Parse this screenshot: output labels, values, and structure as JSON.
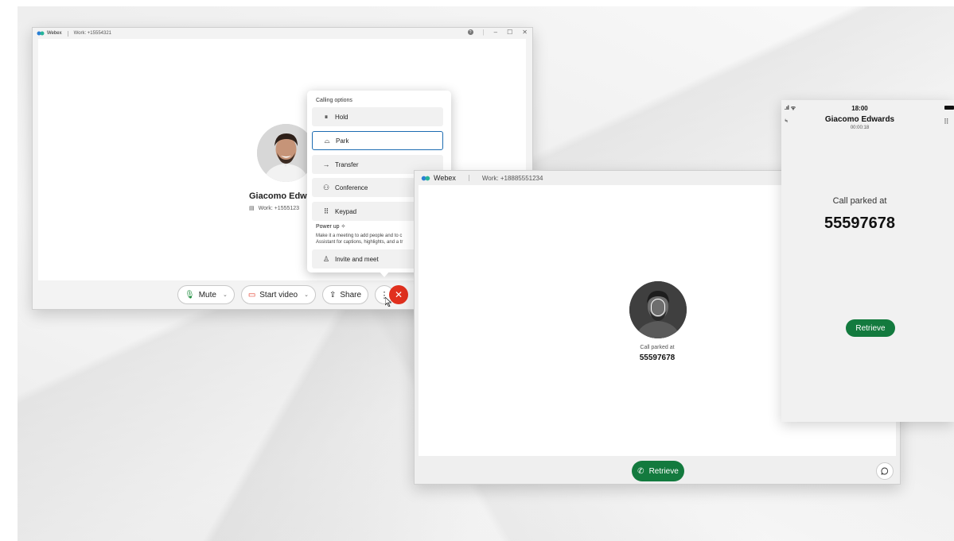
{
  "colors": {
    "accent_green": "#137a3e",
    "end_red": "#e1301e",
    "focus_blue": "#1d6cb2",
    "webex_logo": "#2a7fd4"
  },
  "window1": {
    "app_name": "Webex",
    "line_label": "Work: +15554321",
    "contact_name": "Giacomo Edwar",
    "contact_number": "Work: +1555123",
    "controls": {
      "mute_label": "Mute",
      "start_video_label": "Start video",
      "share_label": "Share"
    }
  },
  "calling_menu": {
    "heading": "Calling options",
    "items": [
      {
        "label": "Hold",
        "icon": "pause-icon"
      },
      {
        "label": "Park",
        "icon": "park-icon"
      },
      {
        "label": "Transfer",
        "icon": "arrow-right-icon"
      },
      {
        "label": "Conference",
        "icon": "people-icon"
      },
      {
        "label": "Keypad",
        "icon": "keypad-icon"
      }
    ],
    "powerup_title": "Power up",
    "powerup_desc_1": "Make it a meeting to add people and to c",
    "powerup_desc_2": "Assistant for captions, highlights, and a tr",
    "invite_label": "Invite and meet"
  },
  "window2": {
    "app_name": "Webex",
    "line_label": "Work: +18885551234",
    "parked_label": "Call parked at",
    "parked_number": "55597678",
    "retrieve_label": "Retrieve"
  },
  "phone": {
    "time": "18:00",
    "contact_name": "Giacomo Edwards",
    "duration": "00:00:18",
    "parked_label": "Call parked at",
    "parked_number": "55597678",
    "retrieve_label": "Retrieve"
  }
}
